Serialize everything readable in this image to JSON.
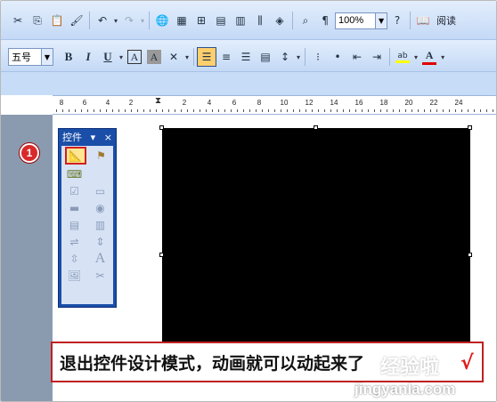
{
  "toolbar_standard": {
    "zoom_value": "100%",
    "read_label": "阅读",
    "icons": [
      "cut-icon",
      "copy-icon",
      "paste-icon",
      "format-painter-icon",
      "undo-icon",
      "redo-icon",
      "hyperlink-icon",
      "tables-borders-icon",
      "insert-table-icon",
      "insert-excel-icon",
      "columns-icon",
      "drawing-icon",
      "document-map-icon",
      "show-hide-icon",
      "help-icon",
      "read-icon"
    ]
  },
  "toolbar_formatting": {
    "font_size": "五号",
    "bold": "B",
    "italic": "I",
    "underline": "U",
    "char_border": "A",
    "char_shading": "A",
    "font_color_label": "A",
    "highlight_label": "ab",
    "accent_colors": {
      "highlight": "#ffff00",
      "font_color": "#e00000",
      "active_align": "#ffcf6e"
    }
  },
  "ruler": {
    "labels": [
      "8",
      "6",
      "4",
      "2",
      "2",
      "4",
      "6",
      "8",
      "10",
      "12",
      "14",
      "16",
      "18",
      "20",
      "22",
      "24"
    ]
  },
  "control_toolbox": {
    "title": "控件",
    "close": "×",
    "dropdown": "▾",
    "tools": [
      "design-mode-icon",
      "properties-icon",
      "view-code-icon",
      "checkbox-icon",
      "textbox-icon",
      "command-button-icon",
      "option-button-icon",
      "listbox-icon",
      "combobox-icon",
      "toggle-button-icon",
      "spin-button-icon",
      "scrollbar-icon",
      "label-icon",
      "image-icon",
      "more-controls-icon"
    ]
  },
  "annotation": {
    "step_number": "1",
    "caption": "退出控件设计模式，动画就可以动起来了",
    "checkmark": "√",
    "watermark_cn": "经验啦",
    "watermark_url": "jingyanla.com"
  }
}
